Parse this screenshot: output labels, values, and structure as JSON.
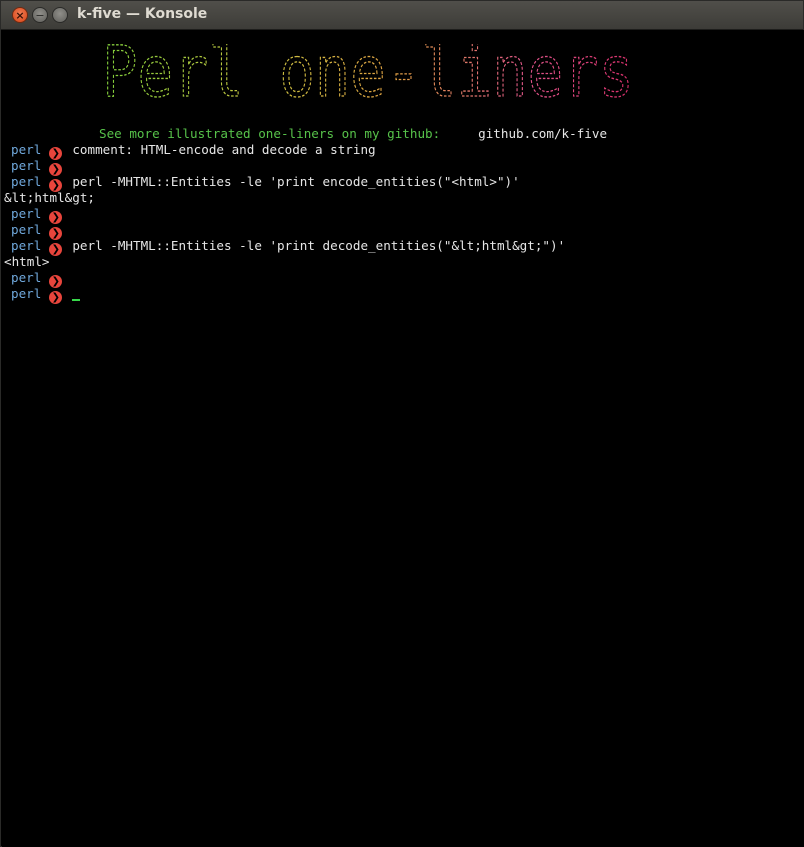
{
  "window": {
    "title": "k-five — Konsole",
    "buttons": {
      "close": "×",
      "minimize": "−",
      "maximize": ""
    }
  },
  "banner": {
    "text": "Perl one-liners",
    "gradient": [
      "#7fcc3a",
      "#c9c440",
      "#e0a043",
      "#e0558a",
      "#d62f6a"
    ]
  },
  "promo": {
    "message": "See more illustrated one-liners on my github:",
    "link": "github.com/k-five"
  },
  "colors": {
    "prompt_name": "#70a8dc",
    "prompt_arrow_bg": "#e8453c",
    "text": "#e6e6e6",
    "promo": "#57c24a",
    "cursor": "#37d84a"
  },
  "terminal": {
    "prompt_name": "perl",
    "prompt_arrow": "❯",
    "lines": [
      {
        "type": "prompt",
        "command": "comment: HTML-encode and decode a string"
      },
      {
        "type": "prompt",
        "command": ""
      },
      {
        "type": "prompt",
        "command": "perl -MHTML::Entities -le 'print encode_entities(\"<html>\")'"
      },
      {
        "type": "output",
        "text": "&lt;html&gt;"
      },
      {
        "type": "prompt",
        "command": ""
      },
      {
        "type": "prompt",
        "command": ""
      },
      {
        "type": "prompt",
        "command": "perl -MHTML::Entities -le 'print decode_entities(\"&lt;html&gt;\")'"
      },
      {
        "type": "output",
        "text": "<html>"
      },
      {
        "type": "prompt",
        "command": ""
      },
      {
        "type": "prompt",
        "command": "",
        "cursor": true
      }
    ]
  }
}
